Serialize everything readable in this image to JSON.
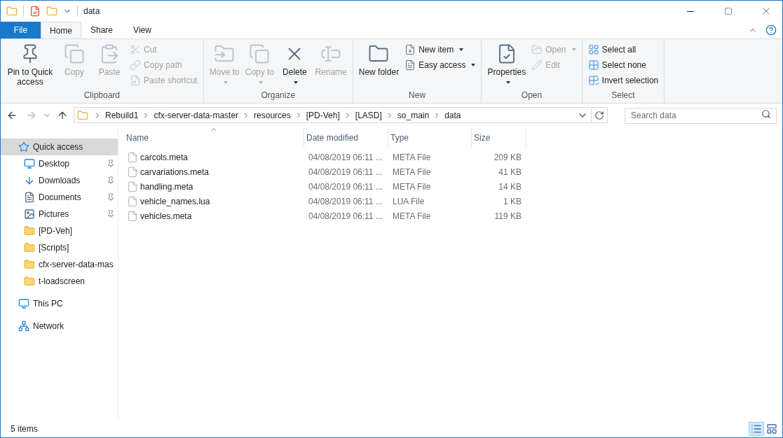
{
  "window": {
    "title": "data"
  },
  "ribbon_tabs": [
    {
      "label": "File",
      "kind": "file",
      "selected": false
    },
    {
      "label": "Home",
      "kind": "tab",
      "selected": true
    },
    {
      "label": "Share",
      "kind": "tab",
      "selected": false
    },
    {
      "label": "View",
      "kind": "tab",
      "selected": false
    }
  ],
  "ribbon_groups": [
    {
      "label": "Clipboard",
      "items": [
        {
          "label": "Pin to Quick access",
          "kind": "large",
          "disabled": false,
          "dropdown": false
        },
        {
          "label": "Copy",
          "kind": "large",
          "disabled": true,
          "dropdown": false
        },
        {
          "label": "Paste",
          "kind": "large",
          "disabled": true,
          "dropdown": false
        },
        {
          "label": "Cut",
          "kind": "small",
          "disabled": true,
          "dropdown": false
        },
        {
          "label": "Copy path",
          "kind": "small",
          "disabled": true,
          "dropdown": false
        },
        {
          "label": "Paste shortcut",
          "kind": "small",
          "disabled": true,
          "dropdown": false
        }
      ]
    },
    {
      "label": "Organize",
      "items": [
        {
          "label": "Move to",
          "kind": "large",
          "disabled": true,
          "dropdown": true
        },
        {
          "label": "Copy to",
          "kind": "large",
          "disabled": true,
          "dropdown": true
        },
        {
          "label": "Delete",
          "kind": "large",
          "disabled": false,
          "dropdown": true
        },
        {
          "label": "Rename",
          "kind": "large",
          "disabled": true,
          "dropdown": false
        }
      ]
    },
    {
      "label": "New",
      "items": [
        {
          "label": "New folder",
          "kind": "large",
          "disabled": false,
          "dropdown": false
        },
        {
          "label": "New item",
          "kind": "small",
          "disabled": false,
          "dropdown": true
        },
        {
          "label": "Easy access",
          "kind": "small",
          "disabled": false,
          "dropdown": true
        }
      ]
    },
    {
      "label": "Open",
      "items": [
        {
          "label": "Properties",
          "kind": "large",
          "disabled": false,
          "dropdown": true
        },
        {
          "label": "Open",
          "kind": "small",
          "disabled": true,
          "dropdown": true
        },
        {
          "label": "Edit",
          "kind": "small",
          "disabled": true,
          "dropdown": false
        }
      ]
    },
    {
      "label": "Select",
      "items": [
        {
          "label": "Select all",
          "kind": "small",
          "disabled": false,
          "dropdown": false
        },
        {
          "label": "Select none",
          "kind": "small",
          "disabled": false,
          "dropdown": false
        },
        {
          "label": "Invert selection",
          "kind": "small",
          "disabled": false,
          "dropdown": false
        }
      ]
    }
  ],
  "address": {
    "crumbs": [
      "Rebuild1",
      "cfx-server-data-master",
      "resources",
      "[PD-Veh]",
      "[LASD]",
      "so_main",
      "data"
    ]
  },
  "search": {
    "placeholder": "Search data"
  },
  "nav": [
    {
      "label": "Quick access",
      "kind": "quick",
      "pinned": false,
      "selected": true
    },
    {
      "label": "Desktop",
      "kind": "desktop",
      "pinned": true,
      "selected": false
    },
    {
      "label": "Downloads",
      "kind": "downloads",
      "pinned": true,
      "selected": false
    },
    {
      "label": "Documents",
      "kind": "documents",
      "pinned": true,
      "selected": false
    },
    {
      "label": "Pictures",
      "kind": "pictures",
      "pinned": true,
      "selected": false
    },
    {
      "label": "[PD-Veh]",
      "kind": "folder",
      "pinned": false,
      "selected": false
    },
    {
      "label": "[Scripts]",
      "kind": "folder",
      "pinned": false,
      "selected": false
    },
    {
      "label": "cfx-server-data-mas",
      "kind": "folder",
      "pinned": false,
      "selected": false
    },
    {
      "label": "t-loadscreen",
      "kind": "folder",
      "pinned": false,
      "selected": false
    },
    {
      "label": "This PC",
      "kind": "pc",
      "pinned": false,
      "selected": false
    },
    {
      "label": "Network",
      "kind": "network",
      "pinned": false,
      "selected": false
    }
  ],
  "table": {
    "columns": [
      "Name",
      "Date modified",
      "Type",
      "Size"
    ],
    "rows": [
      [
        "carcols.meta",
        "04/08/2019 06:11 ...",
        "META File",
        "209 KB"
      ],
      [
        "carvariations.meta",
        "04/08/2019 06:11 ...",
        "META File",
        "41 KB"
      ],
      [
        "handling.meta",
        "04/08/2019 06:11 ...",
        "META File",
        "14 KB"
      ],
      [
        "vehicle_names.lua",
        "04/08/2019 06:11 ...",
        "LUA File",
        "1 KB"
      ],
      [
        "vehicles.meta",
        "04/08/2019 06:11 ...",
        "META File",
        "119 KB"
      ]
    ]
  },
  "status_bar": {
    "text": "5 items",
    "views": [
      {
        "kind": "details",
        "selected": true
      },
      {
        "kind": "thumbnails",
        "selected": false
      }
    ]
  }
}
